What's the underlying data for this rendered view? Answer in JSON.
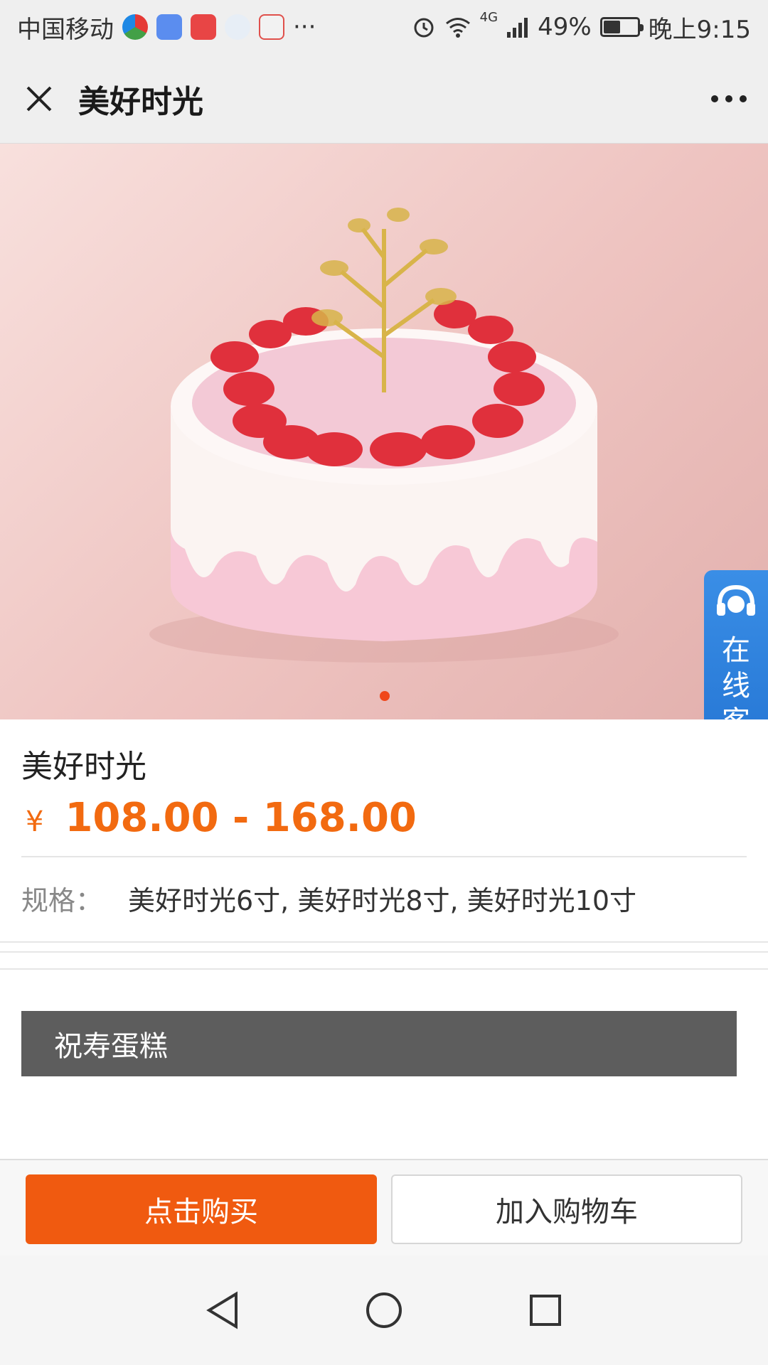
{
  "status_bar": {
    "carrier": "中国移动",
    "battery_percent": "49%",
    "battery_level": 0.49,
    "time": "晚上9:15",
    "network": "4G",
    "overflow": "···"
  },
  "nav": {
    "title": "美好时光",
    "close_icon": "close-icon",
    "more_icon": "more-icon"
  },
  "product": {
    "name": "美好时光",
    "currency": "¥",
    "price_range": "108.00 - 168.00",
    "spec_label": "规格：",
    "spec_value": "美好时光6寸, 美好时光8寸, 美好时光10寸",
    "image_count": 1,
    "active_image": 1
  },
  "support": {
    "label": "在线客服",
    "icon": "headset-icon"
  },
  "category": {
    "label": "祝寿蛋糕"
  },
  "actions": {
    "buy_label": "点击购买",
    "cart_label": "加入购物车"
  },
  "colors": {
    "accent": "#f05a10",
    "price": "#f26a10",
    "support": "#1f6fcf"
  }
}
